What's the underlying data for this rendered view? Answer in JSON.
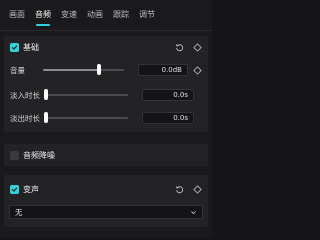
{
  "tabs": [
    {
      "label": "画面"
    },
    {
      "label": "音频"
    },
    {
      "label": "变速"
    },
    {
      "label": "动画"
    },
    {
      "label": "跟踪"
    },
    {
      "label": "调节"
    }
  ],
  "active_tab": "音频",
  "basic": {
    "title": "基础",
    "checked": true,
    "volume": {
      "label": "音量",
      "value": "0.0dB",
      "level": 0.66
    },
    "fade_in": {
      "label": "淡入时长",
      "value": "0.0s",
      "level": 0.0
    },
    "fade_out": {
      "label": "淡出时长",
      "value": "0.0s",
      "level": 0.0
    }
  },
  "noise_reduction": {
    "title": "音频降噪",
    "checked": false
  },
  "voice_change": {
    "title": "变声",
    "checked": true,
    "selected": "无"
  },
  "colors": {
    "accent": "#2fd3df",
    "panel": "#232326",
    "background": "#1a1a1c"
  }
}
